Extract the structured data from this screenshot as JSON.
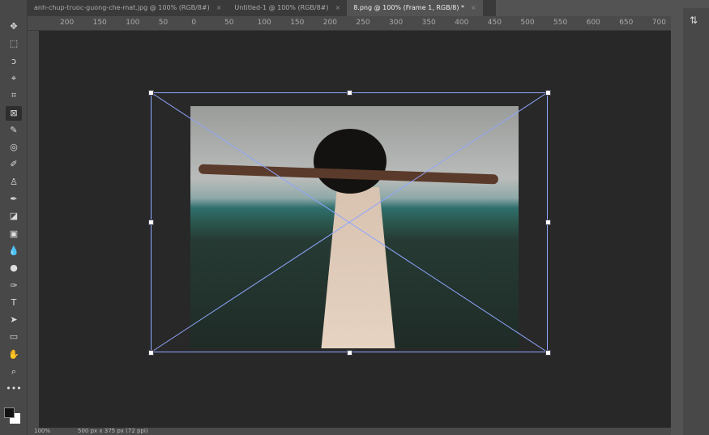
{
  "tabs": [
    {
      "label": "anh-chup-truoc-guong-che-mat.jpg @ 100% (RGB/8#)",
      "close": "×"
    },
    {
      "label": "Untitled-1 @ 100% (RGB/8#)",
      "close": "×"
    },
    {
      "label": "8.png @ 100% (Frame 1, RGB/8) *",
      "close": "×"
    }
  ],
  "ruler": [
    "200",
    "150",
    "100",
    "50",
    "0",
    "50",
    "100",
    "150",
    "200",
    "250",
    "300",
    "350",
    "400",
    "450",
    "500",
    "550",
    "600",
    "650",
    "700"
  ],
  "tools": [
    {
      "icon": "move-icon",
      "glyph": "✥"
    },
    {
      "icon": "marquee-icon",
      "glyph": "⬚"
    },
    {
      "icon": "lasso-icon",
      "glyph": "ↄ"
    },
    {
      "icon": "quick-select-icon",
      "glyph": "⌖"
    },
    {
      "icon": "crop-icon",
      "glyph": "⌗"
    },
    {
      "icon": "frame-icon",
      "glyph": "⊠"
    },
    {
      "icon": "eyedropper-icon",
      "glyph": "✎"
    },
    {
      "icon": "healing-icon",
      "glyph": "◎"
    },
    {
      "icon": "brush-icon",
      "glyph": "✐"
    },
    {
      "icon": "stamp-icon",
      "glyph": "♙"
    },
    {
      "icon": "history-brush-icon",
      "glyph": "✒"
    },
    {
      "icon": "eraser-icon",
      "glyph": "◪"
    },
    {
      "icon": "gradient-icon",
      "glyph": "▣"
    },
    {
      "icon": "blur-icon",
      "glyph": "💧"
    },
    {
      "icon": "dodge-icon",
      "glyph": "●"
    },
    {
      "icon": "pen-icon",
      "glyph": "✑"
    },
    {
      "icon": "type-icon",
      "glyph": "T"
    },
    {
      "icon": "path-select-icon",
      "glyph": "➤"
    },
    {
      "icon": "rectangle-icon",
      "glyph": "▭"
    },
    {
      "icon": "hand-icon",
      "glyph": "✋"
    },
    {
      "icon": "zoom-icon",
      "glyph": "⌕"
    },
    {
      "icon": "more-icon",
      "glyph": "•••"
    }
  ],
  "status": {
    "zoom": "100%",
    "doc_size": "500 px x 375 px (72 ppi)"
  }
}
